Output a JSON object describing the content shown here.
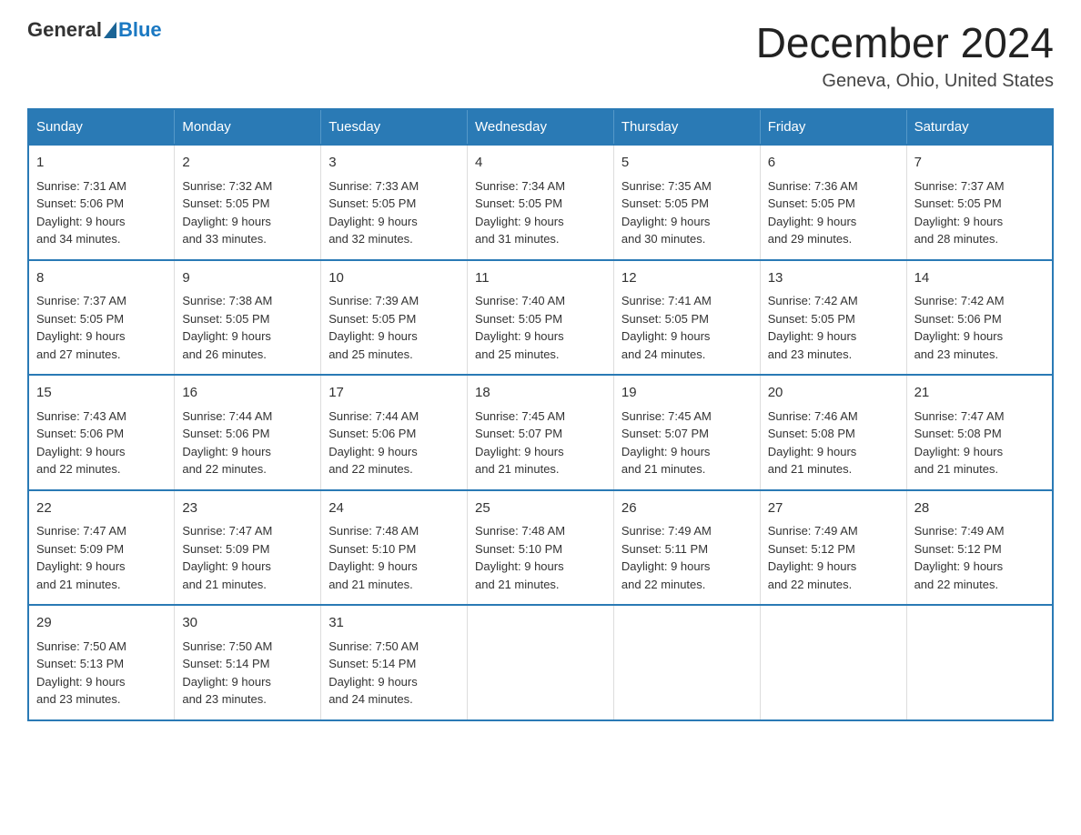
{
  "logo": {
    "general": "General",
    "blue": "Blue"
  },
  "header": {
    "month": "December 2024",
    "location": "Geneva, Ohio, United States"
  },
  "weekdays": [
    "Sunday",
    "Monday",
    "Tuesday",
    "Wednesday",
    "Thursday",
    "Friday",
    "Saturday"
  ],
  "weeks": [
    [
      {
        "day": "1",
        "sunrise": "7:31 AM",
        "sunset": "5:06 PM",
        "daylight": "9 hours and 34 minutes."
      },
      {
        "day": "2",
        "sunrise": "7:32 AM",
        "sunset": "5:05 PM",
        "daylight": "9 hours and 33 minutes."
      },
      {
        "day": "3",
        "sunrise": "7:33 AM",
        "sunset": "5:05 PM",
        "daylight": "9 hours and 32 minutes."
      },
      {
        "day": "4",
        "sunrise": "7:34 AM",
        "sunset": "5:05 PM",
        "daylight": "9 hours and 31 minutes."
      },
      {
        "day": "5",
        "sunrise": "7:35 AM",
        "sunset": "5:05 PM",
        "daylight": "9 hours and 30 minutes."
      },
      {
        "day": "6",
        "sunrise": "7:36 AM",
        "sunset": "5:05 PM",
        "daylight": "9 hours and 29 minutes."
      },
      {
        "day": "7",
        "sunrise": "7:37 AM",
        "sunset": "5:05 PM",
        "daylight": "9 hours and 28 minutes."
      }
    ],
    [
      {
        "day": "8",
        "sunrise": "7:37 AM",
        "sunset": "5:05 PM",
        "daylight": "9 hours and 27 minutes."
      },
      {
        "day": "9",
        "sunrise": "7:38 AM",
        "sunset": "5:05 PM",
        "daylight": "9 hours and 26 minutes."
      },
      {
        "day": "10",
        "sunrise": "7:39 AM",
        "sunset": "5:05 PM",
        "daylight": "9 hours and 25 minutes."
      },
      {
        "day": "11",
        "sunrise": "7:40 AM",
        "sunset": "5:05 PM",
        "daylight": "9 hours and 25 minutes."
      },
      {
        "day": "12",
        "sunrise": "7:41 AM",
        "sunset": "5:05 PM",
        "daylight": "9 hours and 24 minutes."
      },
      {
        "day": "13",
        "sunrise": "7:42 AM",
        "sunset": "5:05 PM",
        "daylight": "9 hours and 23 minutes."
      },
      {
        "day": "14",
        "sunrise": "7:42 AM",
        "sunset": "5:06 PM",
        "daylight": "9 hours and 23 minutes."
      }
    ],
    [
      {
        "day": "15",
        "sunrise": "7:43 AM",
        "sunset": "5:06 PM",
        "daylight": "9 hours and 22 minutes."
      },
      {
        "day": "16",
        "sunrise": "7:44 AM",
        "sunset": "5:06 PM",
        "daylight": "9 hours and 22 minutes."
      },
      {
        "day": "17",
        "sunrise": "7:44 AM",
        "sunset": "5:06 PM",
        "daylight": "9 hours and 22 minutes."
      },
      {
        "day": "18",
        "sunrise": "7:45 AM",
        "sunset": "5:07 PM",
        "daylight": "9 hours and 21 minutes."
      },
      {
        "day": "19",
        "sunrise": "7:45 AM",
        "sunset": "5:07 PM",
        "daylight": "9 hours and 21 minutes."
      },
      {
        "day": "20",
        "sunrise": "7:46 AM",
        "sunset": "5:08 PM",
        "daylight": "9 hours and 21 minutes."
      },
      {
        "day": "21",
        "sunrise": "7:47 AM",
        "sunset": "5:08 PM",
        "daylight": "9 hours and 21 minutes."
      }
    ],
    [
      {
        "day": "22",
        "sunrise": "7:47 AM",
        "sunset": "5:09 PM",
        "daylight": "9 hours and 21 minutes."
      },
      {
        "day": "23",
        "sunrise": "7:47 AM",
        "sunset": "5:09 PM",
        "daylight": "9 hours and 21 minutes."
      },
      {
        "day": "24",
        "sunrise": "7:48 AM",
        "sunset": "5:10 PM",
        "daylight": "9 hours and 21 minutes."
      },
      {
        "day": "25",
        "sunrise": "7:48 AM",
        "sunset": "5:10 PM",
        "daylight": "9 hours and 21 minutes."
      },
      {
        "day": "26",
        "sunrise": "7:49 AM",
        "sunset": "5:11 PM",
        "daylight": "9 hours and 22 minutes."
      },
      {
        "day": "27",
        "sunrise": "7:49 AM",
        "sunset": "5:12 PM",
        "daylight": "9 hours and 22 minutes."
      },
      {
        "day": "28",
        "sunrise": "7:49 AM",
        "sunset": "5:12 PM",
        "daylight": "9 hours and 22 minutes."
      }
    ],
    [
      {
        "day": "29",
        "sunrise": "7:50 AM",
        "sunset": "5:13 PM",
        "daylight": "9 hours and 23 minutes."
      },
      {
        "day": "30",
        "sunrise": "7:50 AM",
        "sunset": "5:14 PM",
        "daylight": "9 hours and 23 minutes."
      },
      {
        "day": "31",
        "sunrise": "7:50 AM",
        "sunset": "5:14 PM",
        "daylight": "9 hours and 24 minutes."
      },
      null,
      null,
      null,
      null
    ]
  ],
  "labels": {
    "sunrise": "Sunrise:",
    "sunset": "Sunset:",
    "daylight": "Daylight:"
  }
}
